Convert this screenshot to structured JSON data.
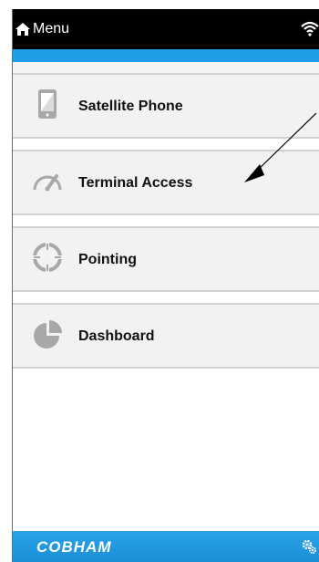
{
  "header": {
    "title": "Menu",
    "home_icon": "home-icon",
    "wifi_icon": "wifi-icon"
  },
  "menu": {
    "items": [
      {
        "label": "Satellite Phone",
        "icon": "phone-tablet-icon"
      },
      {
        "label": "Terminal Access",
        "icon": "gauge-icon"
      },
      {
        "label": "Pointing",
        "icon": "crosshair-icon"
      },
      {
        "label": "Dashboard",
        "icon": "pie-chart-icon"
      }
    ]
  },
  "footer": {
    "brand": "COBHAM",
    "settings_icon": "gears-icon"
  },
  "colors": {
    "topbar": "#000000",
    "accent": "#1e9ee6",
    "item_bg": "#f2f2f2",
    "icon_gray": "#a8a8a8"
  }
}
